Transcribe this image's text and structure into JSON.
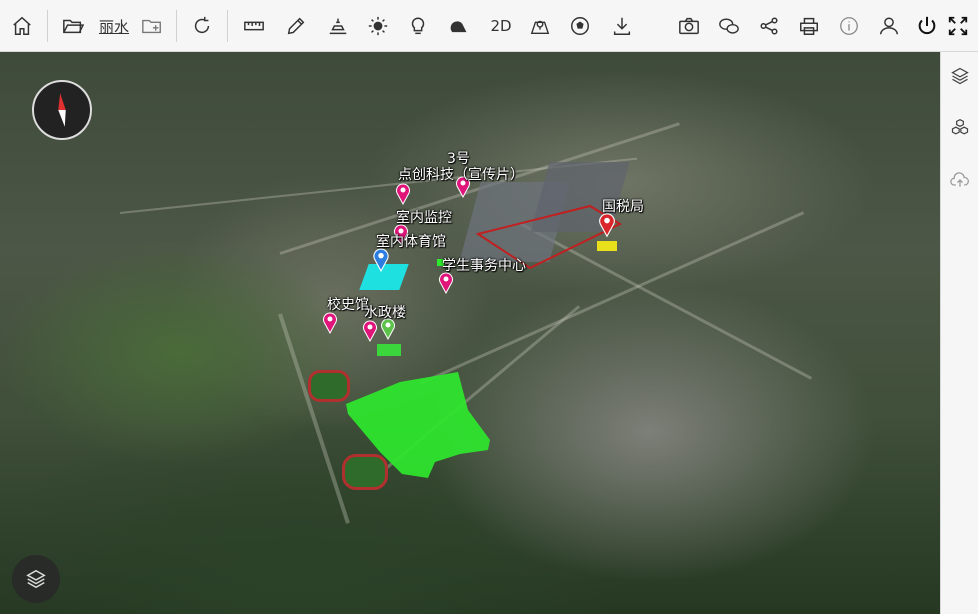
{
  "toolbar": {
    "region_label": "丽水",
    "mode_2d_label": "2D"
  },
  "map": {
    "labels": {
      "guoshuiju": "国税局",
      "dianchuang": "点创科技（宣传片）",
      "building3": "3号",
      "shineijiankong": "室内监控",
      "shineitiyuguan": "室内体育馆",
      "xueshengshiwu": "学生事务中心",
      "xiaoshiguan": "校史馆",
      "shuizhenglou": "水政楼"
    },
    "colors": {
      "pin_pink": "#e0157a",
      "pin_red": "#d9262a",
      "pin_blue": "#2a7fe0",
      "pin_green": "#5cc24a",
      "green_area": "#2ee82e",
      "cyan_area": "#1fe0e0",
      "yellow_area": "#e8e01a"
    }
  }
}
